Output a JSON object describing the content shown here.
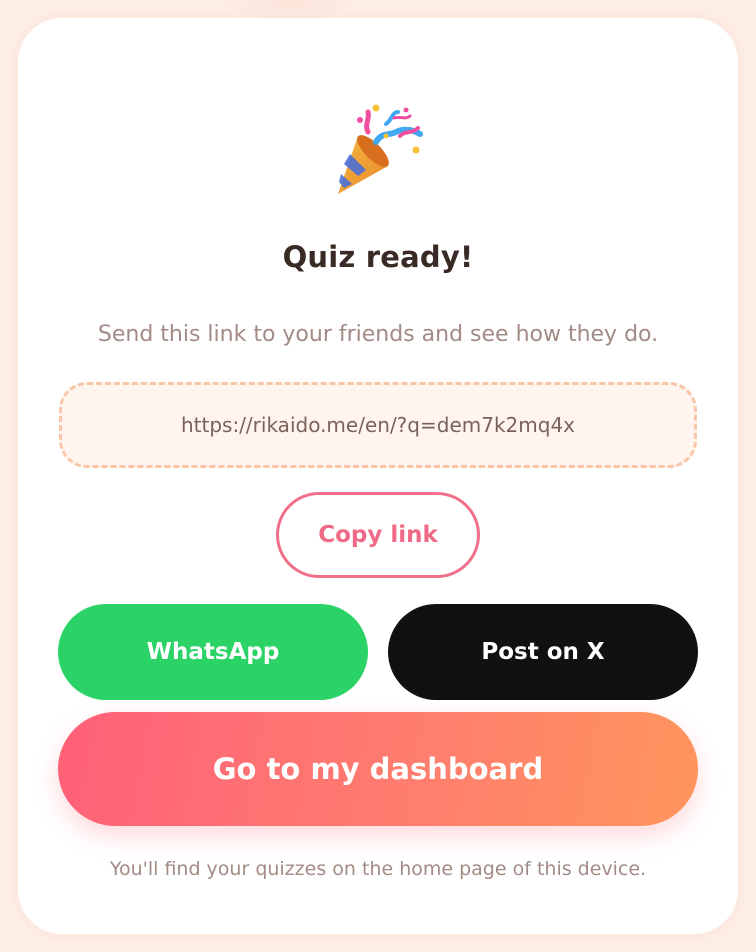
{
  "header": {
    "icon": "party-popper-icon",
    "title": "Quiz ready!",
    "subtitle": "Send this link to your friends and see how they do."
  },
  "share": {
    "link": "https://rikaido.me/en/?q=dem7k2mq4x",
    "copy_label": "Copy link",
    "whatsapp_label": "WhatsApp",
    "x_label": "Post on X"
  },
  "dashboard": {
    "button_label": "Go to my dashboard",
    "note": "You'll find your quizzes on the home page of this device."
  },
  "colors": {
    "accent": "#ef6a86",
    "whatsapp": "#2bd366",
    "x": "#111111",
    "gradient_start": "#ff6079",
    "gradient_end": "#ff955c",
    "link_border": "#f8c5a8"
  }
}
